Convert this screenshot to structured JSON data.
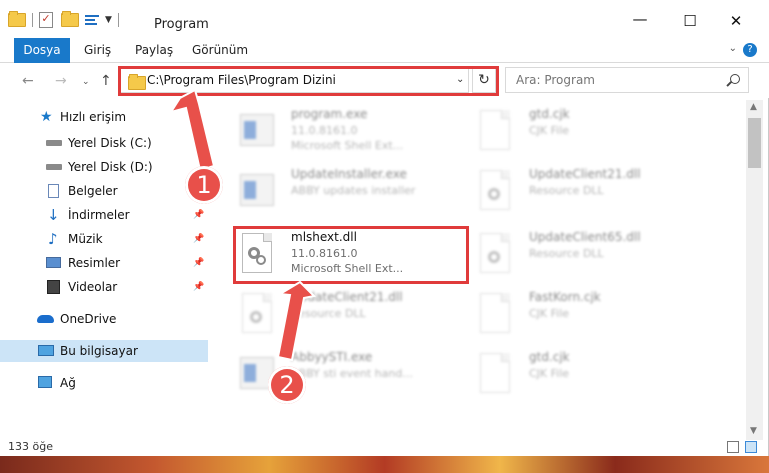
{
  "window": {
    "title": "Program",
    "controls": {
      "minimize": "—",
      "maximize": "☐",
      "close": "✕"
    }
  },
  "ribbon": {
    "tabs": [
      "Dosya",
      "Giriş",
      "Paylaş",
      "Görünüm"
    ],
    "help": "?"
  },
  "nav": {
    "address": "C:\\Program Files\\Program Dizini",
    "search_placeholder": "Ara: Program"
  },
  "sidebar": {
    "items": [
      {
        "label": "Hızlı erişim",
        "icon": "star-icon",
        "pinned": false
      },
      {
        "label": "Yerel Disk (C:)",
        "icon": "drive-icon",
        "pinned": false
      },
      {
        "label": "Yerel Disk (D:)",
        "icon": "drive-icon",
        "pinned": false
      },
      {
        "label": "Belgeler",
        "icon": "documents-icon",
        "pinned": false
      },
      {
        "label": "İndirmeler",
        "icon": "download-icon",
        "pinned": true
      },
      {
        "label": "Müzik",
        "icon": "music-icon",
        "pinned": true
      },
      {
        "label": "Resimler",
        "icon": "pictures-icon",
        "pinned": true
      },
      {
        "label": "Videolar",
        "icon": "video-icon",
        "pinned": true
      },
      {
        "label": "OneDrive",
        "icon": "cloud-icon",
        "pinned": false
      },
      {
        "label": "Bu bilgisayar",
        "icon": "computer-icon",
        "pinned": false,
        "selected": true
      },
      {
        "label": "Ağ",
        "icon": "network-icon",
        "pinned": false
      }
    ]
  },
  "files": [
    {
      "name": "program.exe",
      "line2": "11.0.8161.0",
      "line3": "Microsoft Shell Ext...",
      "type": "exe"
    },
    {
      "name": "gtd.cjk",
      "line2": "CJK File",
      "line3": "",
      "type": "doc"
    },
    {
      "name": "UpdateInstaller.exe",
      "line2": "ABBY updates installer",
      "line3": "",
      "type": "exe"
    },
    {
      "name": "UpdateClient21.dll",
      "line2": "Resource DLL",
      "line3": "",
      "type": "dll"
    },
    {
      "name": "mlshext.dll",
      "line2": "11.0.8161.0",
      "line3": "Microsoft Shell Ext...",
      "type": "dll",
      "highlighted": true
    },
    {
      "name": "UpdateClient65.dll",
      "line2": "Resource DLL",
      "line3": "",
      "type": "dll"
    },
    {
      "name": "UpdateClient21.dll",
      "line2": "Resource DLL",
      "line3": "",
      "type": "dll"
    },
    {
      "name": "FastKorn.cjk",
      "line2": "CJK File",
      "line3": "",
      "type": "doc"
    },
    {
      "name": "AbbyySTI.exe",
      "line2": "ABBY sti event hand...",
      "line3": "",
      "type": "exe"
    },
    {
      "name": "gtd.cjk",
      "line2": "CJK File",
      "line3": "",
      "type": "doc"
    }
  ],
  "status": {
    "item_count": "133 öğe"
  },
  "annotations": {
    "step1": "1",
    "step2": "2",
    "color": "#e03b3b"
  }
}
